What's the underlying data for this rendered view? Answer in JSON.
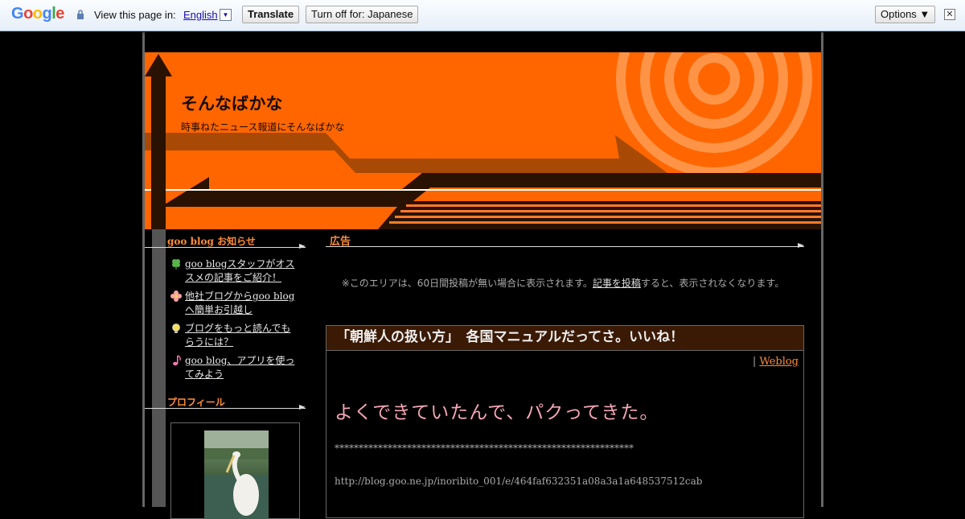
{
  "translate_bar": {
    "logo_parts": [
      "G",
      "o",
      "o",
      "g",
      "l",
      "e"
    ],
    "view_label": "View this page in:",
    "language": "English",
    "dropdown_glyph": "▼",
    "translate_button": "Translate",
    "turn_off_button": "Turn off for: Japanese",
    "options_button": "Options ▼",
    "close_glyph": "✕"
  },
  "header": {
    "title": "そんなばかな",
    "description": "時事ねたニュース報道にそんなばかな"
  },
  "sidebar": {
    "news_heading": "goo blog お知らせ",
    "news_items": [
      {
        "icon": "clover-icon",
        "label": "goo blogスタッフがオススメの記事をご紹介！"
      },
      {
        "icon": "flower-icon",
        "label": "他社ブログからgoo blogへ簡単お引越し"
      },
      {
        "icon": "lightbulb-icon",
        "label": "ブログをもっと読んでもらうには？"
      },
      {
        "icon": "music-note-icon",
        "label": "goo blog、アプリを使ってみよう"
      }
    ],
    "profile_heading": "プロフィール"
  },
  "main": {
    "ad_heading": "広告",
    "ad_note_before": "※このエリアは、60日間投稿が無い場合に表示されます。",
    "ad_note_link": "記事を投稿",
    "ad_note_after": "すると、表示されなくなります。",
    "article": {
      "title": "「朝鮮人の扱い方」　各国マニュアルだってさ。いいね！",
      "category_sep": "|",
      "category": "Weblog",
      "lead": "よくできていたんで、パクってきた。",
      "stars": "**************************************************************",
      "url": "http://blog.goo.ne.jp/inoribito_001/e/464faf632351a08a3a1a648537512cab"
    }
  },
  "colors": {
    "accent_orange": "#ff6600",
    "heading_orange": "#ff8c3a",
    "lead_pink": "#f4a6b5"
  }
}
